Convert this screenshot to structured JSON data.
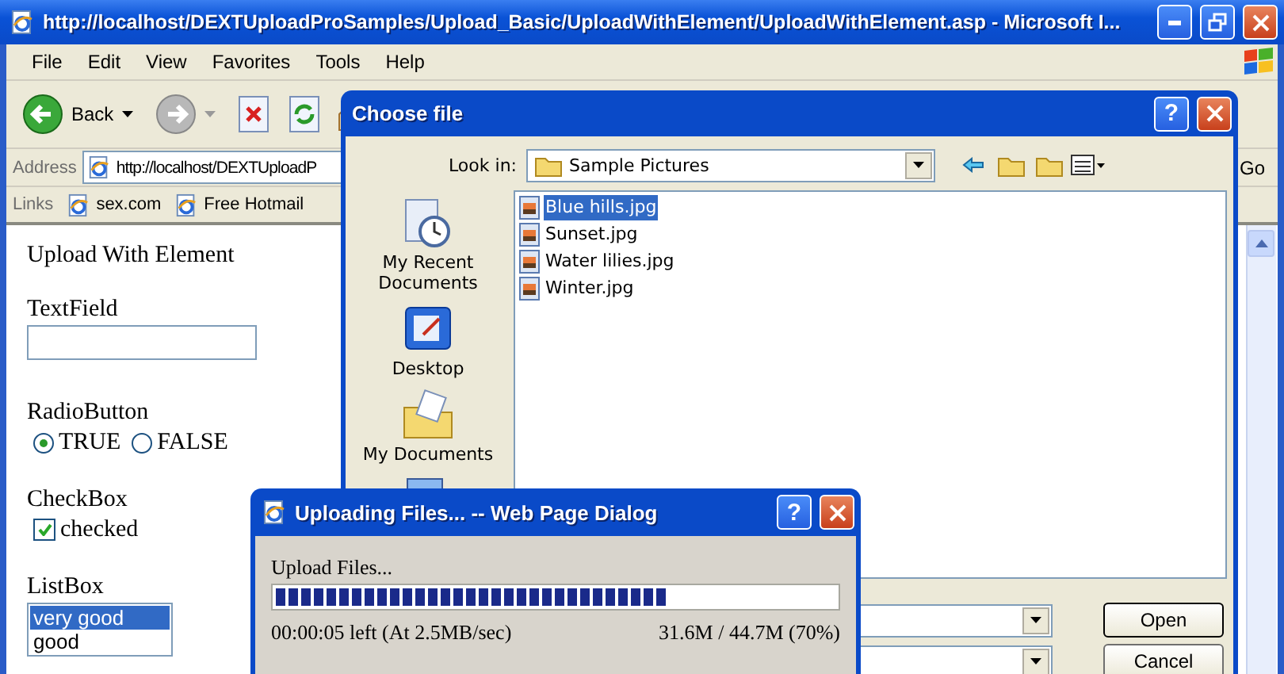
{
  "browser": {
    "title": "http://localhost/DEXTUploadProSamples/Upload_Basic/UploadWithElement/UploadWithElement.asp - Microsoft I...",
    "menu": [
      "File",
      "Edit",
      "View",
      "Favorites",
      "Tools",
      "Help"
    ],
    "back_label": "Back",
    "address": {
      "label": "Address",
      "value": "http://localhost/DEXTUploadP",
      "go": "Go"
    },
    "links": {
      "label": "Links",
      "items": [
        "sex.com",
        "Free Hotmail"
      ]
    }
  },
  "page": {
    "heading": "Upload With Element",
    "text_field": {
      "label": "TextField"
    },
    "radio": {
      "label": "RadioButton",
      "options": [
        {
          "label": "TRUE",
          "selected": true
        },
        {
          "label": "FALSE",
          "selected": false
        }
      ]
    },
    "checkbox": {
      "label": "CheckBox",
      "option": "checked",
      "checked": true
    },
    "list_box": {
      "label": "ListBox",
      "items": [
        {
          "label": "very good",
          "selected": true
        },
        {
          "label": "good",
          "selected": false
        }
      ]
    }
  },
  "choose_file": {
    "title": "Choose file",
    "help": "?",
    "look_in": {
      "label": "Look in:",
      "value": "Sample Pictures"
    },
    "places": [
      {
        "kind": "recent",
        "label": "My Recent Documents"
      },
      {
        "kind": "desktop",
        "label": "Desktop"
      },
      {
        "kind": "documents",
        "label": "My Documents"
      },
      {
        "kind": "computer"
      }
    ],
    "files": [
      {
        "name": "Blue hills.jpg",
        "selected": true
      },
      {
        "name": "Sunset.jpg",
        "selected": false
      },
      {
        "name": "Water lilies.jpg",
        "selected": false
      },
      {
        "name": "Winter.jpg",
        "selected": false
      }
    ],
    "buttons": [
      "Open",
      "Cancel"
    ]
  },
  "upload_dialog": {
    "title": "Uploading Files... -- Web Page Dialog",
    "help": "?",
    "status": "Upload Files...",
    "level": 0.7,
    "time_left": "00:00:05 left (At 2.5MB/sec)",
    "transferred": "31.6M / 44.7M (70%)"
  }
}
